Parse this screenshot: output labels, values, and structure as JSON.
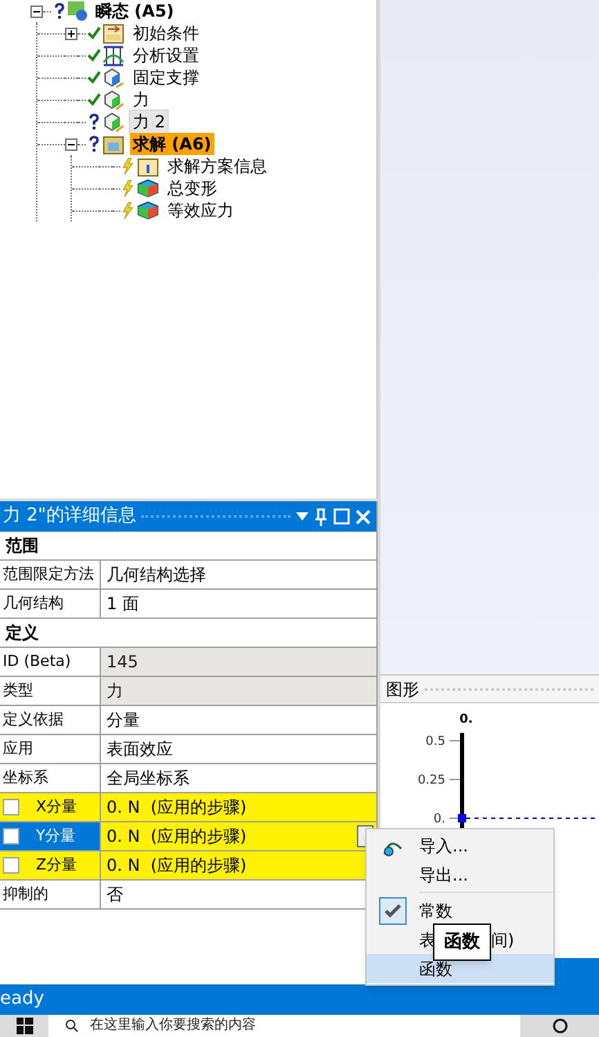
{
  "tree": [
    {
      "label": "瞬态 (A5)",
      "kind": "analysis",
      "status": {
        "kind": "unknown"
      },
      "bold": true,
      "highlighted": false,
      "selected": false,
      "expanded": true,
      "children": [
        {
          "label": "初始条件",
          "kind": "initial",
          "status": {
            "kind": "ok"
          },
          "bold": false,
          "highlighted": false,
          "selected": false,
          "expanded": false
        },
        {
          "label": "分析设置",
          "kind": "settings",
          "status": {
            "kind": "ok"
          },
          "bold": false,
          "highlighted": false,
          "selected": false
        },
        {
          "label": "固定支撑",
          "kind": "support",
          "status": {
            "kind": "ok"
          },
          "bold": false,
          "highlighted": false,
          "selected": false
        },
        {
          "label": "力",
          "kind": "force",
          "status": {
            "kind": "ok"
          },
          "bold": false,
          "highlighted": false,
          "selected": false
        },
        {
          "label": "力 2",
          "kind": "force",
          "status": {
            "kind": "unknown"
          },
          "bold": false,
          "highlighted": false,
          "selected": true
        },
        {
          "label": "求解 (A6)",
          "kind": "solution",
          "status": {
            "kind": "unknown"
          },
          "bold": true,
          "highlighted": true,
          "selected": false,
          "expanded": true,
          "children": [
            {
              "label": "求解方案信息",
              "kind": "info",
              "status": {
                "kind": "pending"
              },
              "bold": false,
              "highlighted": false,
              "selected": false
            },
            {
              "label": "总变形",
              "kind": "result",
              "status": {
                "kind": "pending"
              },
              "bold": false,
              "highlighted": false,
              "selected": false
            },
            {
              "label": "等效应力",
              "kind": "result",
              "status": {
                "kind": "pending"
              },
              "bold": false,
              "highlighted": false,
              "selected": false
            }
          ]
        }
      ]
    }
  ],
  "details": {
    "title": "力 2\"的详细信息",
    "rows": [
      {
        "kind": "section",
        "label": "范围"
      },
      {
        "kind": "property",
        "label": "范围限定方法",
        "value": "几何结构选择",
        "readonly": false,
        "highlight": false,
        "selected": false
      },
      {
        "kind": "property",
        "label": "几何结构",
        "value": "1 面",
        "readonly": false,
        "highlight": false,
        "selected": false
      },
      {
        "kind": "section",
        "label": "定义"
      },
      {
        "kind": "property",
        "label": "ID (Beta)",
        "value": "145",
        "readonly": true,
        "highlight": false,
        "selected": false
      },
      {
        "kind": "property",
        "label": "类型",
        "value": "力",
        "readonly": true,
        "highlight": false,
        "selected": false
      },
      {
        "kind": "property",
        "label": "定义依据",
        "value": "分量",
        "readonly": false,
        "highlight": false,
        "selected": false
      },
      {
        "kind": "property",
        "label": "应用",
        "value": "表面效应",
        "readonly": false,
        "highlight": false,
        "selected": false
      },
      {
        "kind": "property",
        "label": "坐标系",
        "value": "全局坐标系",
        "readonly": false,
        "highlight": false,
        "selected": false
      },
      {
        "kind": "property",
        "label": "X分量",
        "value": "0. N  (应用的步骤)",
        "readonly": false,
        "highlight": true,
        "selected": false,
        "checked": false
      },
      {
        "kind": "property",
        "label": "Y分量",
        "value": "0. N  (应用的步骤)",
        "readonly": false,
        "highlight": true,
        "selected": true,
        "checked": false
      },
      {
        "kind": "property",
        "label": "Z分量",
        "value": "0. N  (应用的步骤)",
        "readonly": false,
        "highlight": true,
        "selected": false,
        "checked": false
      },
      {
        "kind": "property",
        "label": "抑制的",
        "value": "否",
        "readonly": false,
        "highlight": false,
        "selected": false
      }
    ]
  },
  "graph": {
    "title": "图形",
    "chart_data": {
      "type": "line",
      "categories": [
        "0."
      ],
      "ylim": [
        -0.1,
        0.55
      ],
      "yticks": [
        {
          "value": 0,
          "label": "0."
        },
        {
          "value": 0.25,
          "label": "0.25"
        },
        {
          "value": 0.5,
          "label": "0.5"
        }
      ],
      "series": [
        {
          "color": "#0000ff",
          "marker": "square",
          "values": [
            0
          ]
        }
      ],
      "ref_lines": [
        {
          "axis": "y",
          "value": 0,
          "color": "#0000ff"
        }
      ]
    }
  },
  "menu": [
    {
      "kind": "command",
      "label": "导入...",
      "icon": true,
      "checked": false,
      "selected": false
    },
    {
      "kind": "command",
      "label": "导出...",
      "icon": false,
      "checked": false,
      "selected": false
    },
    {
      "kind": "separator"
    },
    {
      "kind": "command",
      "label": "常数",
      "icon": false,
      "checked": true,
      "selected": false
    },
    {
      "kind": "covered",
      "label_start": "表",
      "label_end": "间)",
      "icon": false,
      "checked": false,
      "selected": false
    },
    {
      "kind": "command",
      "label": "函数",
      "icon": false,
      "checked": false,
      "selected": true
    }
  ],
  "tooltip": "函数",
  "status_bar": "eady",
  "taskbar": {
    "search_placeholder": "在这里输入你要搜索的内容"
  }
}
